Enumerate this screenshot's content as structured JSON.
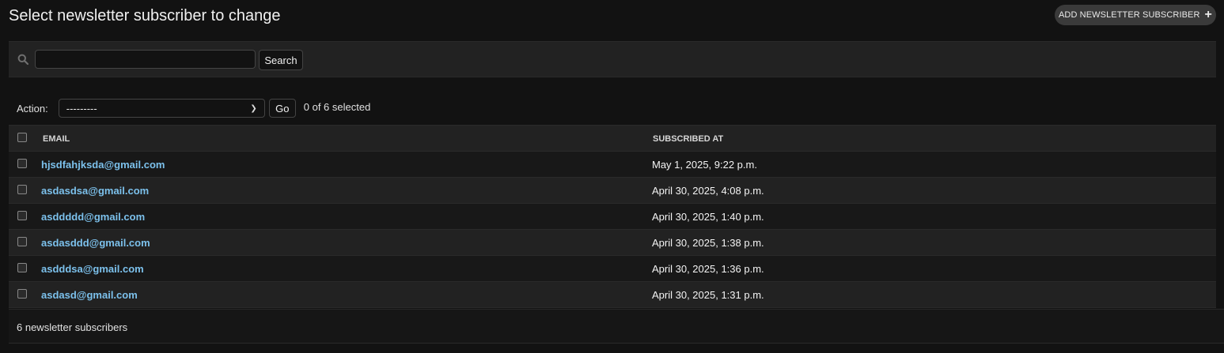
{
  "header": {
    "title": "Select newsletter subscriber to change",
    "add_button_label": "ADD NEWSLETTER SUBSCRIBER",
    "add_icon": "plus-icon"
  },
  "search": {
    "value": "",
    "button_label": "Search",
    "icon": "search-icon"
  },
  "actions": {
    "label": "Action:",
    "selected_option": "---------",
    "go_label": "Go",
    "selection_count": "0 of 6 selected"
  },
  "table": {
    "columns": [
      "EMAIL",
      "SUBSCRIBED AT"
    ],
    "rows": [
      {
        "email": "hjsdfahjksda@gmail.com",
        "subscribed_at": "May 1, 2025, 9:22 p.m."
      },
      {
        "email": "asdasdsa@gmail.com",
        "subscribed_at": "April 30, 2025, 4:08 p.m."
      },
      {
        "email": "asddddd@gmail.com",
        "subscribed_at": "April 30, 2025, 1:40 p.m."
      },
      {
        "email": "asdasddd@gmail.com",
        "subscribed_at": "April 30, 2025, 1:38 p.m."
      },
      {
        "email": "asdddsa@gmail.com",
        "subscribed_at": "April 30, 2025, 1:36 p.m."
      },
      {
        "email": "asdasd@gmail.com",
        "subscribed_at": "April 30, 2025, 1:31 p.m."
      }
    ]
  },
  "footer": {
    "count_text": "6 newsletter subscribers"
  },
  "colors": {
    "background": "#121212",
    "link": "#7cc1ec",
    "bar": "#222222"
  }
}
